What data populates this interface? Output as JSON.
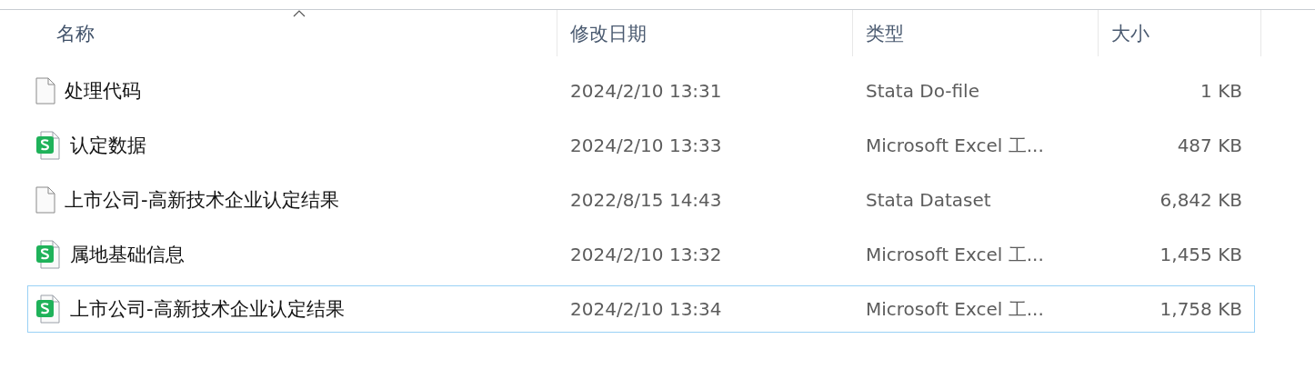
{
  "columns": [
    {
      "label": "名称",
      "sorted": true
    },
    {
      "label": "修改日期",
      "sorted": false
    },
    {
      "label": "类型",
      "sorted": false
    },
    {
      "label": "大小",
      "sorted": false
    }
  ],
  "files": [
    {
      "kind": "blank",
      "name": "处理代码",
      "modified": "2024/2/10 13:31",
      "type": "Stata Do-file",
      "size": "1 KB",
      "focused": false
    },
    {
      "kind": "spreadsheet",
      "name": "认定数据",
      "modified": "2024/2/10 13:33",
      "type": "Microsoft Excel 工...",
      "size": "487 KB",
      "focused": false
    },
    {
      "kind": "blank",
      "name": "上市公司-高新技术企业认定结果",
      "modified": "2022/8/15 14:43",
      "type": "Stata Dataset",
      "size": "6,842 KB",
      "focused": false
    },
    {
      "kind": "spreadsheet",
      "name": "属地基础信息",
      "modified": "2024/2/10 13:32",
      "type": "Microsoft Excel 工...",
      "size": "1,455 KB",
      "focused": false
    },
    {
      "kind": "spreadsheet",
      "name": "上市公司-高新技术企业认定结果",
      "modified": "2024/2/10 13:34",
      "type": "Microsoft Excel 工...",
      "size": "1,758 KB",
      "focused": true
    }
  ]
}
